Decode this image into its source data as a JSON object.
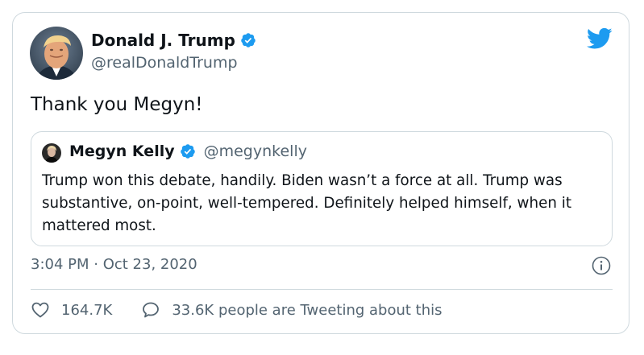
{
  "author": {
    "name": "Donald J. Trump",
    "handle": "@realDonaldTrump"
  },
  "tweet": {
    "text": "Thank you Megyn!"
  },
  "quoted": {
    "name": "Megyn Kelly",
    "handle": "@megynkelly",
    "text": "Trump won this debate, handily. Biden wasn’t a force at all. Trump was substantive, on-point, well-tempered. Definitely helped himself, when it mattered most."
  },
  "meta": {
    "timestamp": "3:04 PM · Oct 23, 2020"
  },
  "actions": {
    "likes": "164.7K",
    "conversation": "33.6K people are Tweeting about this"
  },
  "colors": {
    "brand": "#1d9bf0",
    "secondary_text": "#536471",
    "border": "#cfd9de"
  },
  "icons": {
    "logo": "twitter-bird-icon",
    "verified": "verified-badge-icon",
    "info": "info-icon",
    "like": "heart-icon",
    "reply": "speech-bubble-icon"
  }
}
